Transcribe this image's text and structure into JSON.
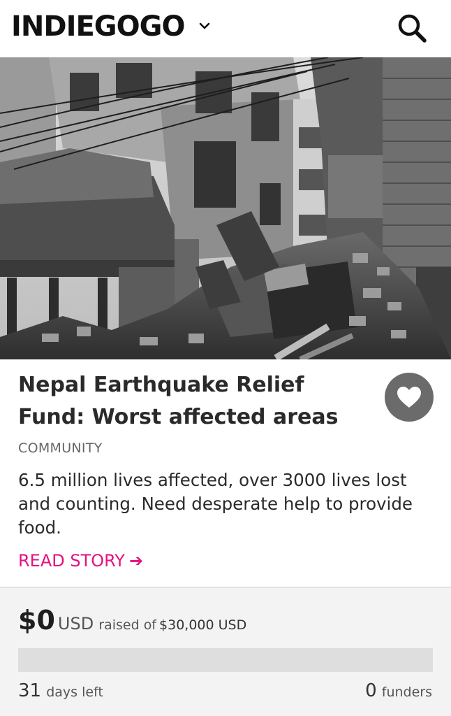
{
  "header": {
    "logo_text": "INDIEGOGO",
    "menu_icon": "chevron-down-icon",
    "search_icon": "search-icon"
  },
  "campaign": {
    "image_icon": "earthquake-rubble-photo",
    "title": "Nepal Earthquake Relief Fund: Worst affected areas",
    "favorite_icon": "heart-icon",
    "category": "COMMUNITY",
    "blurb": "6.5 million lives affected, over 3000 lives lost and counting. Need desperate help to provide food.",
    "read_story": "READ STORY",
    "read_story_arrow": "➔"
  },
  "funding": {
    "amount": "$0",
    "amount_unit": "USD",
    "raised_of": "raised of",
    "goal": "$30,000 USD",
    "progress_fraction": 0,
    "days_left_num": "31",
    "days_left_label": "days left",
    "funders_num": "0",
    "funders_label": "funders"
  },
  "colors": {
    "accent": "#e5117f",
    "progress_track": "#dedede",
    "funding_bg": "#f4f3f3",
    "fav_button": "#6b6b6b"
  }
}
